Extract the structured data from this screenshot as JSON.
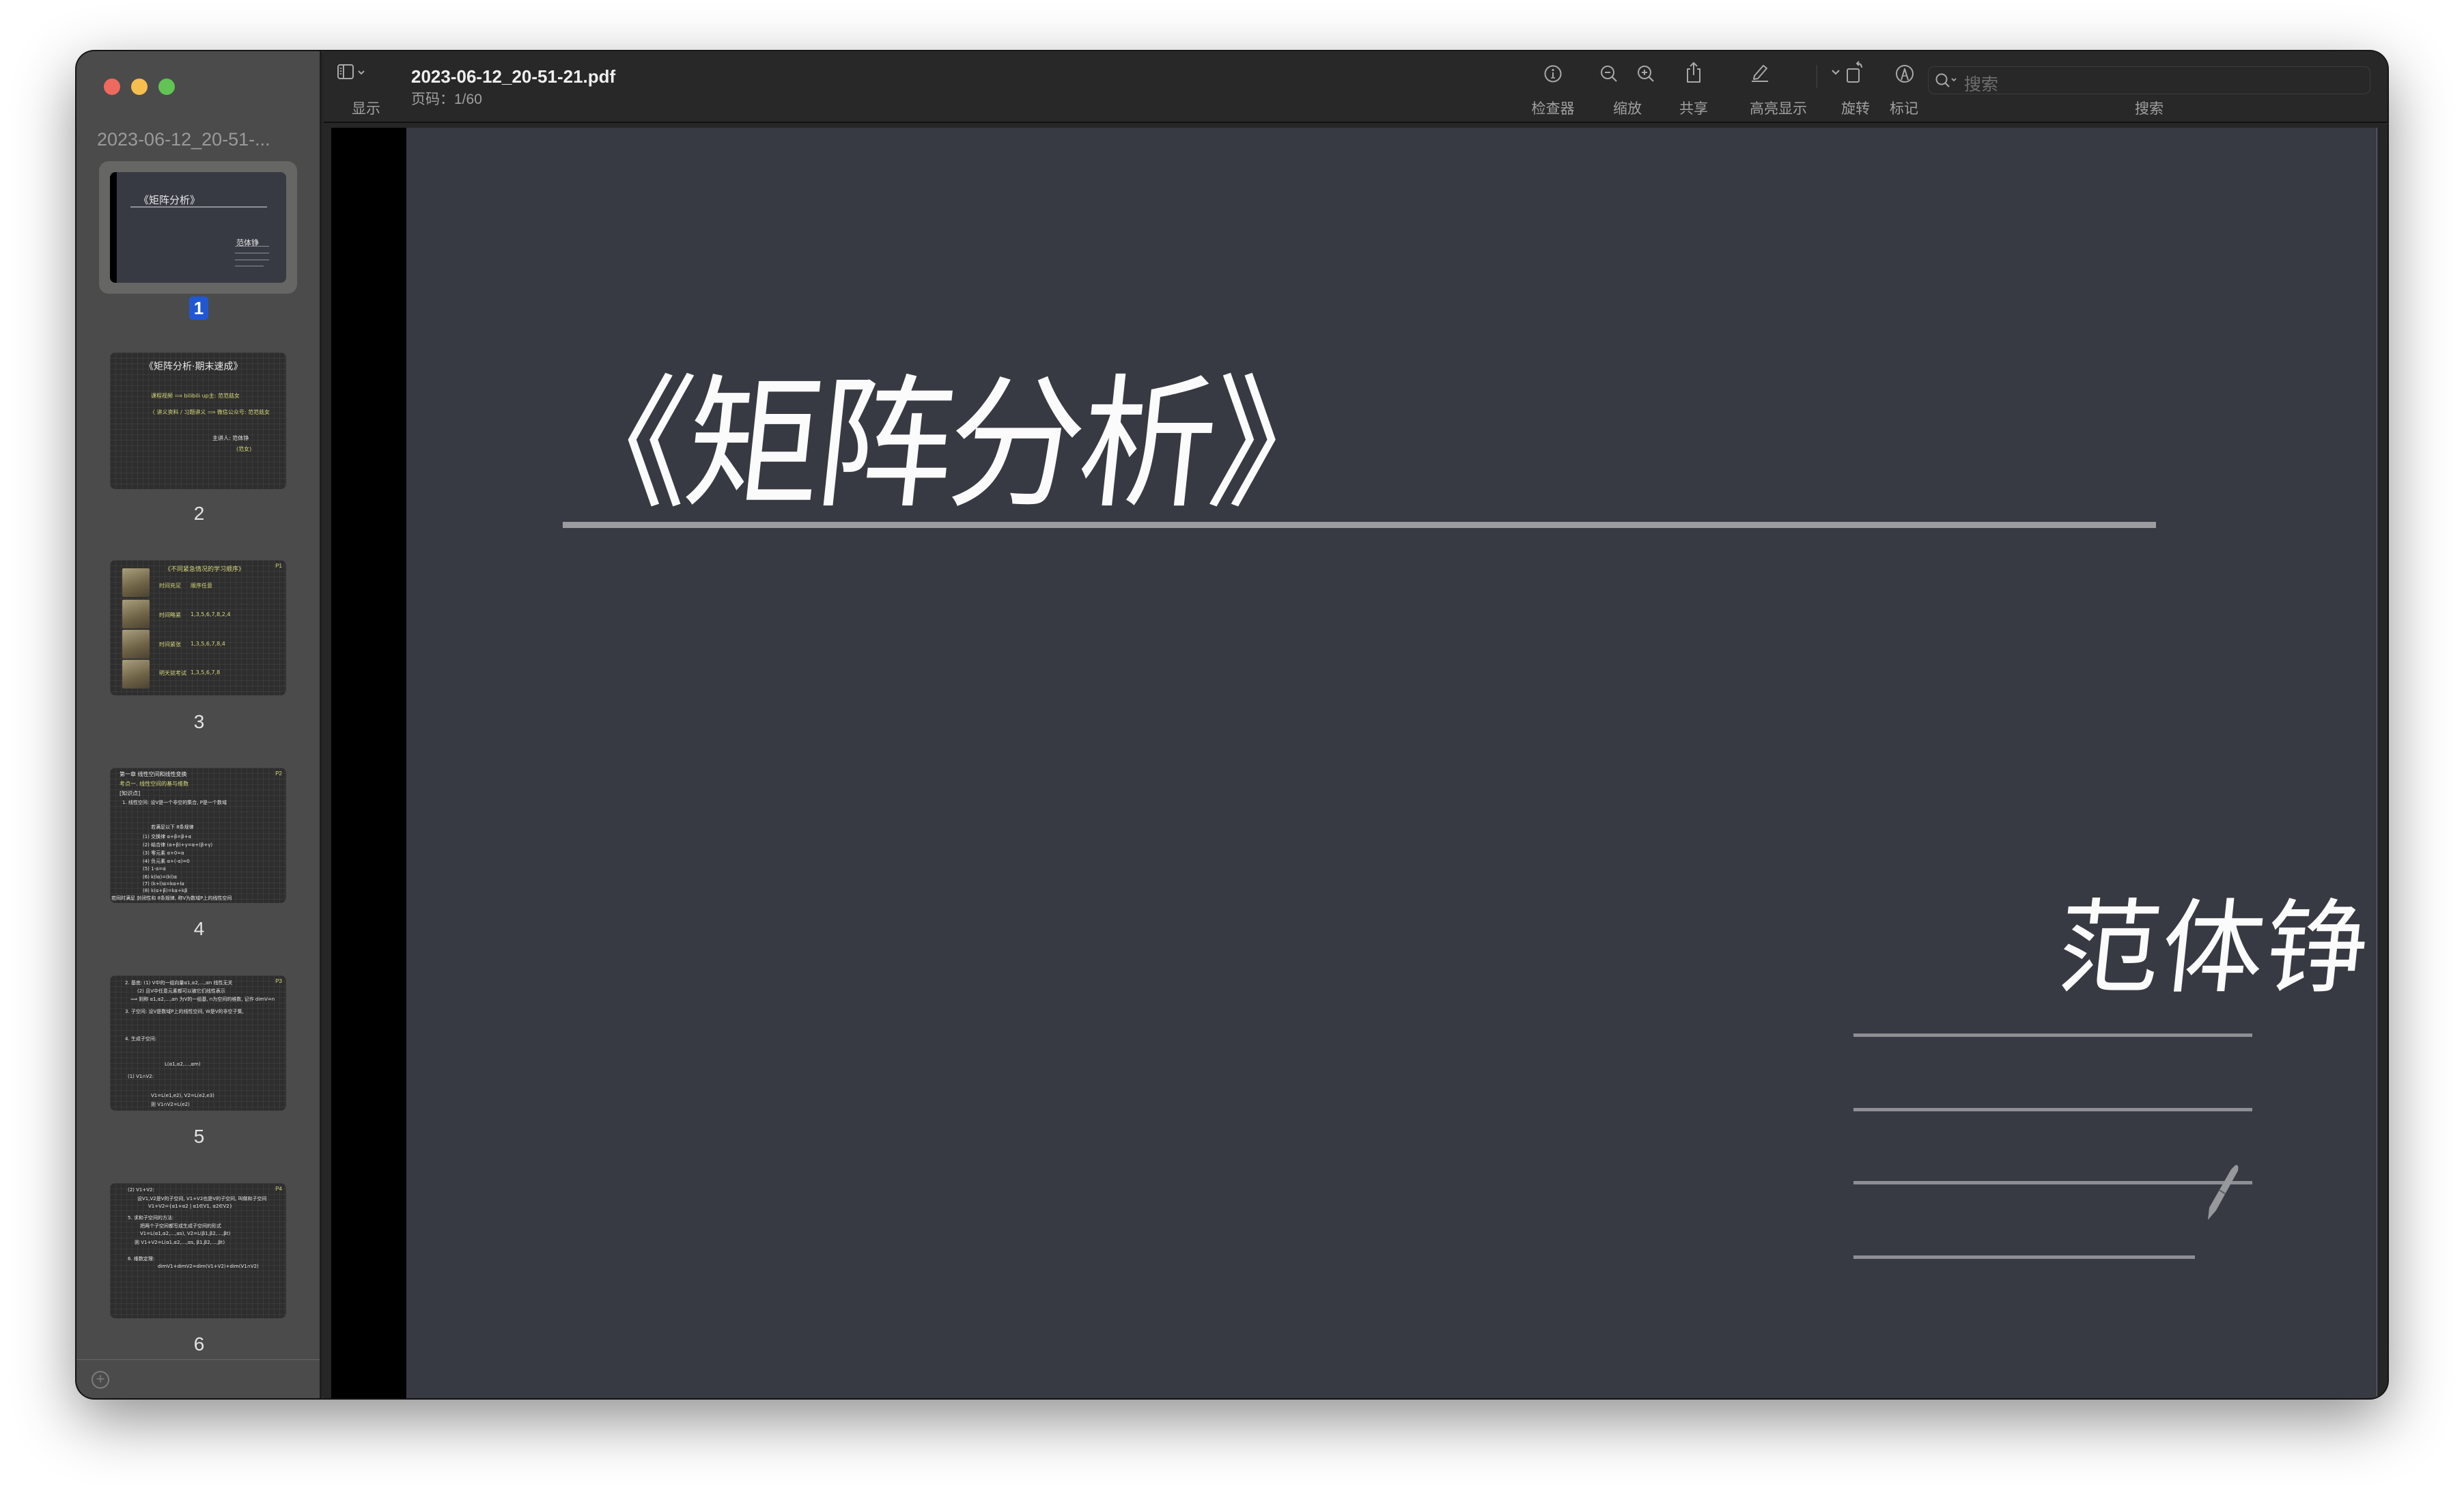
{
  "window": {
    "controls": [
      "close",
      "minimize",
      "zoom"
    ]
  },
  "sidebar": {
    "document_title": "2023-06-12_20-51-...",
    "selected_page": "1",
    "thumbnails": [
      {
        "page": "1",
        "title": "《矩阵分析》",
        "author": "范体铮"
      },
      {
        "page": "2",
        "title": "《矩阵分析·期末速成》",
        "lines": [
          "课程视频 ⟹ bilibili up主: 范范菇女",
          "〈 讲义资料 / 习题讲义 ⟹ 微信公众号: 范范菇女",
          "主讲人: 范体铮",
          "(范女)"
        ]
      },
      {
        "page": "3",
        "title": "《不同紧急情况的学习顺序》",
        "tag": "P1",
        "rows": [
          {
            "label": "时间充足",
            "value": "顺序任意"
          },
          {
            "label": "时间略紧",
            "value": "1,3,5,6,7,8,2,4"
          },
          {
            "label": "时间紧张",
            "value": "1,3,5,6,7,8,4"
          },
          {
            "label": "明天就考试",
            "value": "1,3,5,6,7,8"
          }
        ]
      },
      {
        "page": "4",
        "tag": "P2",
        "lines": [
          "第一章 线性空间和线性变换",
          "考点一. 线性空间的基与维数",
          "[知识点]",
          "1. 线性空间: 设V是一个非空的集合, P是一个数域",
          "若满足以下 8条规律",
          "(1) 交换律 α+β=β+α",
          "(2) 结合律 (α+β)+γ=α+(β+γ)",
          "(3) 零元素 α+0=α",
          "(4) 负元素 α+(-α)=0",
          "(5) 1·α=α",
          "(6) k(lα)=(kl)α",
          "(7) (k+l)α=kα+lα",
          "(8) k(α+β)=kα+kβ",
          "若同时满足 封闭性和 8条规律, 称V为数域P上的线性空间"
        ]
      },
      {
        "page": "5",
        "tag": "P3",
        "lines": [
          "2. 基底: (1) V中的一组向量α1,α2,…,αn 线性无关",
          "(2) 且V中任意元素都可以被它们线性表示",
          "⟹ 则称 α1,α2,…,αn 为V的一组基, n为空间的维数, 记作 dimV=n",
          "3. 子空间: 设V是数域P上的线性空间, W是V的非空子集,",
          "4. 生成子空间:",
          "L(α1,α2,…,αm)",
          "(1) V1∩V2:",
          "V1=L(e1,e2), V2=L(e2,e3)",
          "则 V1∩V2=L(e2)"
        ]
      },
      {
        "page": "6",
        "tag": "P4",
        "lines": [
          "(2) V1+V2:",
          "设V1,V2是V的子空间, V1+V2也是V的子空间, 叫做和子空间",
          "V1+V2={α1+α2 | α1∈V1, α2∈V2}",
          "5. 求和子空间的方法:",
          "把两个子空间都写成生成子空间的形式",
          "V1=L(α1,α2,…,αs), V2=L(β1,β2,…,βt)",
          "则 V1+V2=L(α1,α2,…,αs, β1,β2,…,βt)",
          "6. 维数定理:",
          "dimV1+dimV2=dim(V1+V2)+dim(V1∩V2)"
        ]
      }
    ],
    "add_icon": "plus-circle-icon"
  },
  "toolbar": {
    "sidebar_toggle_label": "显示",
    "file_name": "2023-06-12_20-51-21.pdf",
    "page_indicator": "页码：1/60",
    "inspector_label": "检查器",
    "zoom_label": "缩放",
    "share_label": "共享",
    "highlight_label": "高亮显示",
    "rotate_label": "旋转",
    "markup_label": "标记",
    "search_label": "搜索",
    "search_placeholder": "搜索"
  },
  "document": {
    "current_page": {
      "title": "《矩阵分析》",
      "author": "范体铮"
    }
  }
}
